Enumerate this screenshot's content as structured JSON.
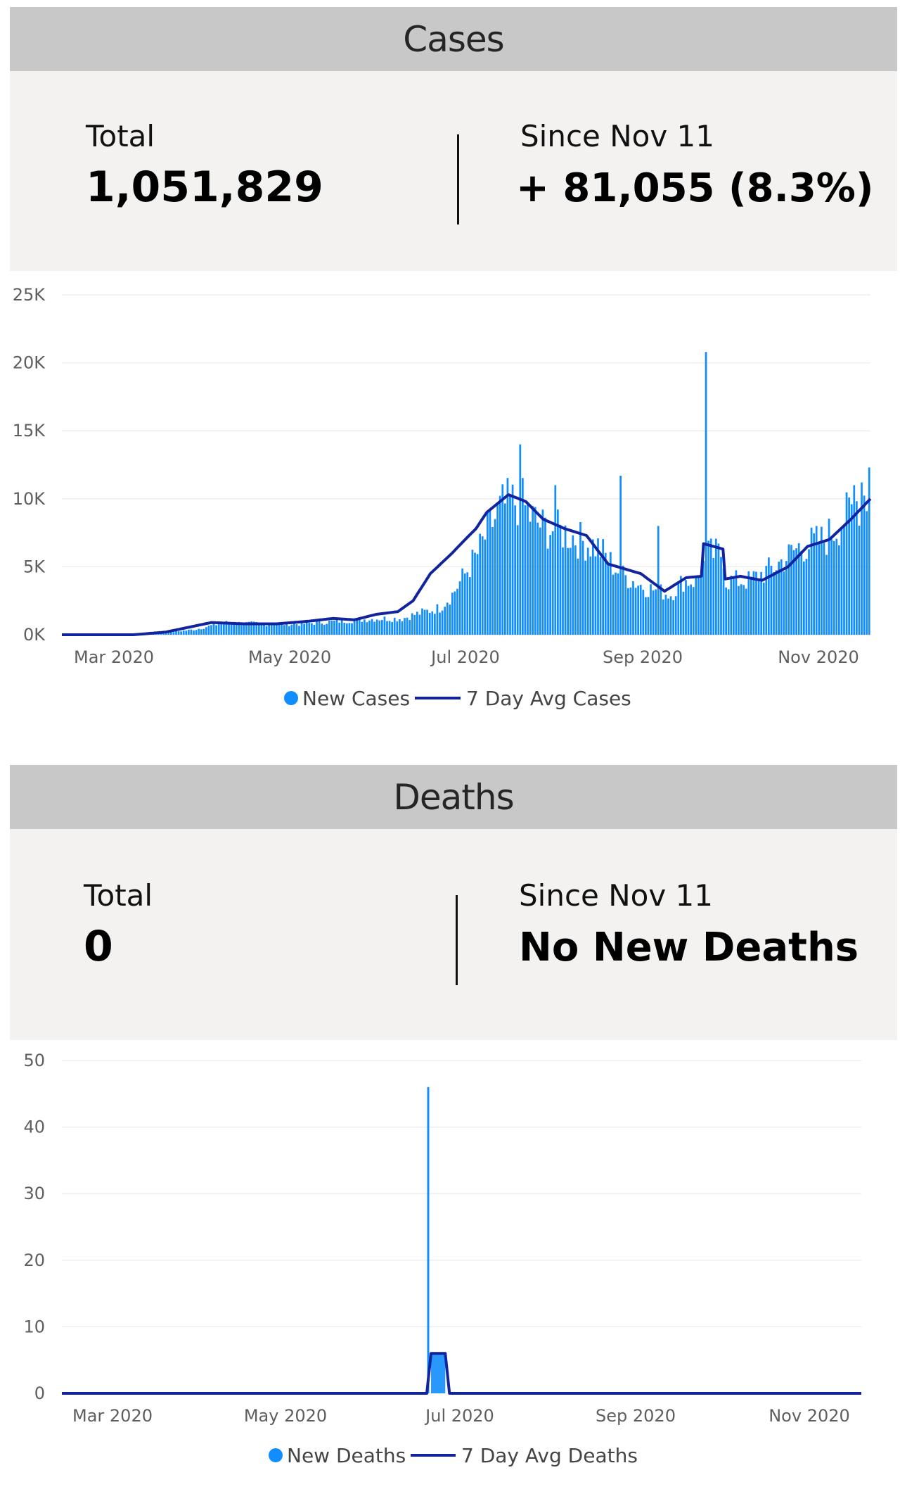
{
  "cases": {
    "header": "Cases",
    "total_label": "Total",
    "total_value": "1,051,829",
    "since_label": "Since Nov 11",
    "since_value": "+ 81,055 (8.3%)"
  },
  "deaths": {
    "header": "Deaths",
    "total_label": "Total",
    "total_value": "0",
    "since_label": "Since Nov 11",
    "since_value": "No New Deaths"
  },
  "colors": {
    "bar": "#118dff",
    "avg": "#12239e",
    "grid": "#eeeeee"
  },
  "chart_data": [
    {
      "type": "bar",
      "bar_series_name": "New Cases",
      "line_series_name": "7 Day Avg Cases",
      "x_start": "2020-02-01",
      "x_end": "2020-11-18",
      "x_ticks": [
        "Mar 2020",
        "May 2020",
        "Jul 2020",
        "Sep 2020",
        "Nov 2020"
      ],
      "y_ticks": [
        "0K",
        "5K",
        "10K",
        "15K",
        "20K",
        "25K"
      ],
      "ylim": [
        0,
        25000
      ],
      "grid": true,
      "legend": "bottom-center",
      "keypoints_bar": [
        [
          "2020-02-01",
          0
        ],
        [
          "2020-02-25",
          0
        ],
        [
          "2020-03-10",
          100
        ],
        [
          "2020-03-25",
          400
        ],
        [
          "2020-04-05",
          900
        ],
        [
          "2020-04-20",
          800
        ],
        [
          "2020-05-05",
          800
        ],
        [
          "2020-05-20",
          1000
        ],
        [
          "2020-06-05",
          1200
        ],
        [
          "2020-06-15",
          1200
        ],
        [
          "2020-06-20",
          1500
        ],
        [
          "2020-06-30",
          2000
        ],
        [
          "2020-07-05",
          3000
        ],
        [
          "2020-07-10",
          4500
        ],
        [
          "2020-07-15",
          6000
        ],
        [
          "2020-07-20",
          8000
        ],
        [
          "2020-07-25",
          9500
        ],
        [
          "2020-08-01",
          10000
        ],
        [
          "2020-08-05",
          8800
        ],
        [
          "2020-08-10",
          8000
        ],
        [
          "2020-08-20",
          7500
        ],
        [
          "2020-08-25",
          7000
        ],
        [
          "2020-09-01",
          6500
        ],
        [
          "2020-09-10",
          4500
        ],
        [
          "2020-09-20",
          3500
        ],
        [
          "2020-09-30",
          3000
        ],
        [
          "2020-10-05",
          4000
        ],
        [
          "2020-10-10",
          4000
        ],
        [
          "2020-10-15",
          6000
        ],
        [
          "2020-10-21",
          6000
        ],
        [
          "2020-10-22",
          4000
        ],
        [
          "2020-10-31",
          4000
        ],
        [
          "2020-11-10",
          5000
        ],
        [
          "2020-11-20",
          6500
        ],
        [
          "2020-11-30",
          7000
        ],
        [
          "2020-12-10",
          9000
        ],
        [
          "2020-12-18",
          11000
        ]
      ],
      "spikes": [
        [
          "2020-10-14",
          20800
        ],
        [
          "2020-08-01",
          14000
        ],
        [
          "2020-09-10",
          11700
        ],
        [
          "2020-08-15",
          11000
        ],
        [
          "2020-12-15",
          11200
        ],
        [
          "2020-12-18",
          12300
        ],
        [
          "2020-12-12",
          11000
        ],
        [
          "2020-09-25",
          8000
        ]
      ],
      "keypoints_avg": [
        [
          "2020-02-01",
          0
        ],
        [
          "2020-02-25",
          0
        ],
        [
          "2020-03-05",
          0
        ],
        [
          "2020-03-20",
          200
        ],
        [
          "2020-04-01",
          600
        ],
        [
          "2020-04-10",
          900
        ],
        [
          "2020-04-25",
          800
        ],
        [
          "2020-05-10",
          800
        ],
        [
          "2020-05-25",
          1000
        ],
        [
          "2020-06-05",
          1200
        ],
        [
          "2020-06-15",
          1100
        ],
        [
          "2020-06-25",
          1500
        ],
        [
          "2020-07-05",
          1700
        ],
        [
          "2020-07-12",
          2500
        ],
        [
          "2020-07-20",
          4500
        ],
        [
          "2020-07-30",
          6000
        ],
        [
          "2020-08-05",
          7000
        ],
        [
          "2020-08-10",
          7800
        ],
        [
          "2020-08-15",
          9000
        ],
        [
          "2020-08-25",
          10300
        ],
        [
          "2020-09-02",
          9800
        ],
        [
          "2020-09-10",
          8500
        ],
        [
          "2020-09-20",
          7800
        ],
        [
          "2020-09-30",
          7300
        ],
        [
          "2020-10-10",
          5200
        ],
        [
          "2020-10-25",
          4500
        ],
        [
          "2020-11-05",
          3200
        ],
        [
          "2020-11-15",
          4200
        ],
        [
          "2020-11-22",
          4300
        ],
        [
          "2020-11-23",
          6700
        ],
        [
          "2020-12-02",
          6300
        ],
        [
          "2020-12-03",
          4100
        ],
        [
          "2020-12-10",
          4300
        ],
        [
          "2020-12-20",
          4000
        ],
        [
          "2021-01-01",
          5000
        ],
        [
          "2021-01-10",
          6500
        ],
        [
          "2021-01-20",
          7000
        ],
        [
          "2021-01-30",
          8500
        ],
        [
          "2021-02-08",
          10000
        ]
      ]
    },
    {
      "type": "bar",
      "bar_series_name": "New Deaths",
      "line_series_name": "7 Day Avg Deaths",
      "x_ticks": [
        "Mar 2020",
        "May 2020",
        "Jul 2020",
        "Sep 2020",
        "Nov 2020"
      ],
      "y_ticks": [
        "0",
        "10",
        "20",
        "30",
        "40",
        "50"
      ],
      "ylim": [
        0,
        50
      ],
      "grid": true,
      "legend": "bottom-center",
      "spike_date": "2020-06-20",
      "spike_value": 46,
      "avg_plateau": 6,
      "avg_plateau_start": "2020-06-21",
      "avg_plateau_end": "2020-06-26"
    }
  ]
}
